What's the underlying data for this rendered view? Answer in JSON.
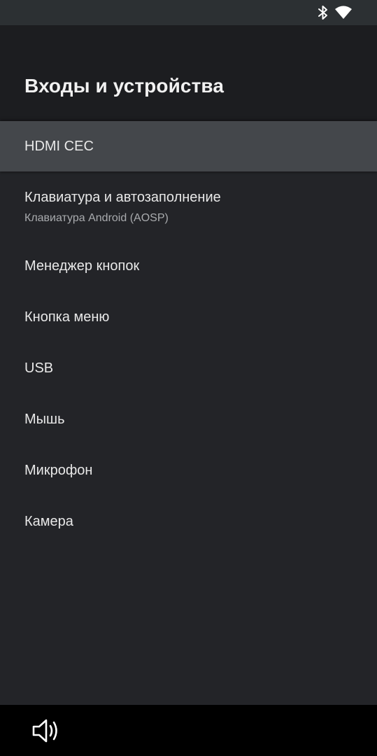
{
  "status_bar": {
    "icons": [
      "bluetooth-icon",
      "wifi-icon"
    ]
  },
  "header": {
    "title": "Входы и устройства"
  },
  "menu": {
    "items": [
      {
        "label": "HDMI CEC",
        "sublabel": "",
        "selected": true
      },
      {
        "label": "Клавиатура и автозаполнение",
        "sublabel": "Клавиатура Android (AOSP)",
        "selected": false
      },
      {
        "label": "Менеджер кнопок",
        "sublabel": "",
        "selected": false
      },
      {
        "label": "Кнопка меню",
        "sublabel": "",
        "selected": false
      },
      {
        "label": "USB",
        "sublabel": "",
        "selected": false
      },
      {
        "label": "Мышь",
        "sublabel": "",
        "selected": false
      },
      {
        "label": "Микрофон",
        "sublabel": "",
        "selected": false
      },
      {
        "label": "Камера",
        "sublabel": "",
        "selected": false
      }
    ]
  },
  "nav_bar": {
    "icons": [
      "volume-icon"
    ]
  },
  "colors": {
    "background": "#232428",
    "header": "#1c1d20",
    "status_bar": "#2c3033",
    "selected_item": "#44474b",
    "nav_bar": "#000000"
  }
}
